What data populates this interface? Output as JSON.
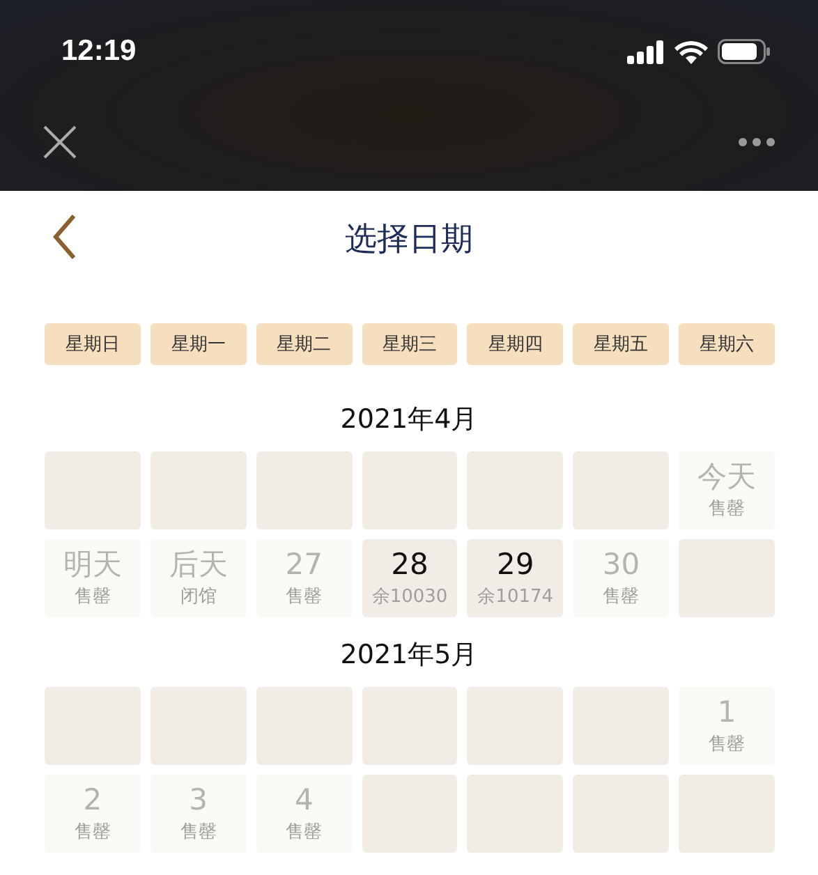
{
  "status_bar": {
    "time": "12:19"
  },
  "page": {
    "title": "选择日期"
  },
  "weekdays": [
    "星期日",
    "星期一",
    "星期二",
    "星期三",
    "星期四",
    "星期五",
    "星期六"
  ],
  "months": [
    {
      "label": "2021年4月",
      "days": [
        {
          "kind": "empty"
        },
        {
          "kind": "empty"
        },
        {
          "kind": "empty"
        },
        {
          "kind": "empty"
        },
        {
          "kind": "empty"
        },
        {
          "kind": "empty"
        },
        {
          "kind": "unavailable",
          "day": "今天",
          "note": "售罄"
        },
        {
          "kind": "unavailable",
          "day": "明天",
          "note": "售罄"
        },
        {
          "kind": "unavailable",
          "day": "后天",
          "note": "闭馆"
        },
        {
          "kind": "unavailable",
          "day": "27",
          "note": "售罄"
        },
        {
          "kind": "available",
          "day": "28",
          "note": "余10030"
        },
        {
          "kind": "available",
          "day": "29",
          "note": "余10174"
        },
        {
          "kind": "unavailable",
          "day": "30",
          "note": "售罄"
        },
        {
          "kind": "empty"
        }
      ]
    },
    {
      "label": "2021年5月",
      "days": [
        {
          "kind": "empty"
        },
        {
          "kind": "empty"
        },
        {
          "kind": "empty"
        },
        {
          "kind": "empty"
        },
        {
          "kind": "empty"
        },
        {
          "kind": "empty"
        },
        {
          "kind": "unavailable",
          "day": "1",
          "note": "售罄"
        },
        {
          "kind": "unavailable",
          "day": "2",
          "note": "售罄"
        },
        {
          "kind": "unavailable",
          "day": "3",
          "note": "售罄"
        },
        {
          "kind": "unavailable",
          "day": "4",
          "note": "售罄"
        },
        {
          "kind": "empty"
        },
        {
          "kind": "empty"
        },
        {
          "kind": "empty"
        },
        {
          "kind": "empty"
        }
      ]
    }
  ]
}
